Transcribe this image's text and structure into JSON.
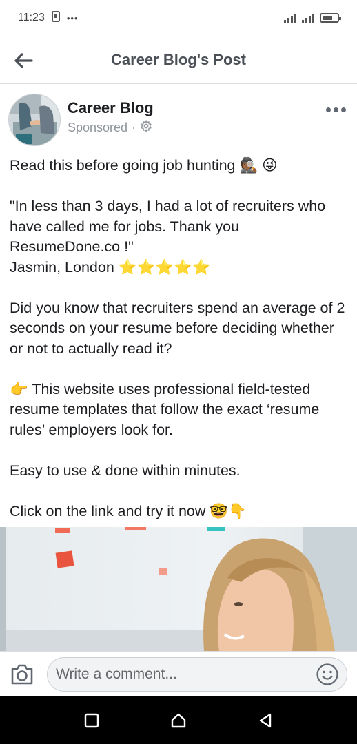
{
  "status_bar": {
    "time": "11:23",
    "dots": "•••"
  },
  "header": {
    "title": "Career Blog's Post",
    "back_icon": "arrow-left-icon"
  },
  "post": {
    "page_name": "Career Blog",
    "sponsored_label": "Sponsored",
    "separator": "·",
    "paragraphs": [
      "Read this before going job hunting 🕵🏾 😜",
      "\"In less than 3 days, I had a lot of recruiters who have called me for jobs. Thank you ResumeDone.co !\"\nJasmin, London ⭐⭐⭐⭐⭐",
      "Did you know that recruiters spend an average of 2 seconds on your resume before deciding whether or not to actually read it?",
      "👉 This website uses professional field-tested resume templates that follow the exact ‘resume rules’ employers look for.",
      "Easy to use & done within minutes.",
      "Click on the link and try it now 🤓👇"
    ]
  },
  "comment_bar": {
    "placeholder": "Write a comment..."
  },
  "colors": {
    "header_text": "#4b4f56",
    "secondary_text": "#90949c",
    "divider": "#dcdde1",
    "nav_background": "#000000"
  }
}
